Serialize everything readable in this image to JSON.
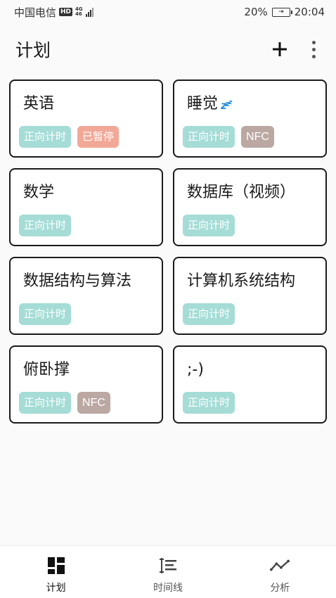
{
  "status_bar": {
    "carrier": "中国电信",
    "hd": "HD",
    "network_top": "4G",
    "network_bottom": "46",
    "battery_percent": "20%",
    "time": "20:04"
  },
  "app_bar": {
    "title": "计划"
  },
  "plans": [
    {
      "title": "英语",
      "icon": null,
      "tags": [
        {
          "label": "正向计时",
          "kind": "timer"
        },
        {
          "label": "已暂停",
          "kind": "paused"
        }
      ]
    },
    {
      "title": "睡觉",
      "icon": "zzz-icon",
      "tags": [
        {
          "label": "正向计时",
          "kind": "timer"
        },
        {
          "label": "NFC",
          "kind": "nfc"
        }
      ]
    },
    {
      "title": "数学",
      "icon": null,
      "tags": [
        {
          "label": "正向计时",
          "kind": "timer"
        }
      ]
    },
    {
      "title": "数据库（视频）",
      "icon": null,
      "tags": [
        {
          "label": "正向计时",
          "kind": "timer"
        }
      ]
    },
    {
      "title": "数据结构与算法",
      "icon": null,
      "tags": [
        {
          "label": "正向计时",
          "kind": "timer"
        }
      ]
    },
    {
      "title": "计算机系统结构",
      "icon": null,
      "tags": [
        {
          "label": "正向计时",
          "kind": "timer"
        }
      ]
    },
    {
      "title": "俯卧撑",
      "icon": null,
      "tags": [
        {
          "label": "正向计时",
          "kind": "timer"
        },
        {
          "label": "NFC",
          "kind": "nfc"
        }
      ]
    },
    {
      "title": ";-)",
      "icon": null,
      "tags": [
        {
          "label": "正向计时",
          "kind": "timer"
        }
      ]
    }
  ],
  "bottom_nav": {
    "items": [
      {
        "label": "计划",
        "icon": "dashboard-icon",
        "active": true
      },
      {
        "label": "时间线",
        "icon": "timeline-icon",
        "active": false
      },
      {
        "label": "分析",
        "icon": "trend-icon",
        "active": false
      }
    ]
  },
  "colors": {
    "tag_timer": "#a5dcd6",
    "tag_paused": "#f2a897",
    "tag_nfc": "#bba8a3",
    "card_border": "#1a1a1a"
  }
}
